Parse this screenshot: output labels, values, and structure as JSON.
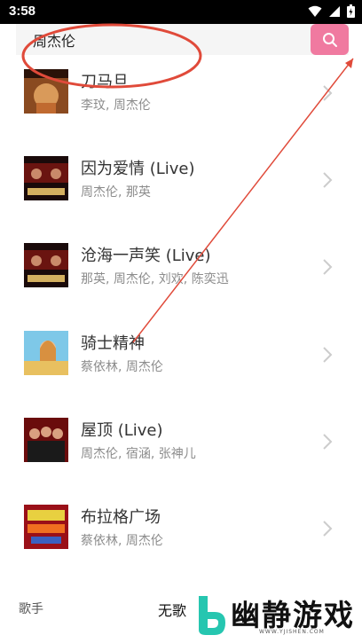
{
  "status_bar": {
    "time": "3:58"
  },
  "search": {
    "query": "周杰伦",
    "button_icon": "search-icon",
    "button_color": "#f07aa0"
  },
  "songs": [
    {
      "title": "刀马旦",
      "artists": "李玟, 周杰伦"
    },
    {
      "title": "因为爱情 (Live)",
      "artists": "周杰伦, 那英"
    },
    {
      "title": "沧海一声笑 (Live)",
      "artists": "那英, 周杰伦, 刘欢, 陈奕迅"
    },
    {
      "title": "骑士精神",
      "artists": "蔡依林, 周杰伦"
    },
    {
      "title": "屋顶 (Live)",
      "artists": "周杰伦, 宿涵, 张神儿"
    },
    {
      "title": "布拉格广场",
      "artists": "蔡依林, 周杰伦"
    }
  ],
  "tabs": {
    "singer": "歌手",
    "active": "无歌"
  },
  "watermark": {
    "text": "幽静游戏",
    "url": "WWW.YJISHEN.COM"
  },
  "colors": {
    "annotation": "#e04a3a",
    "chevron": "#cccccc"
  }
}
